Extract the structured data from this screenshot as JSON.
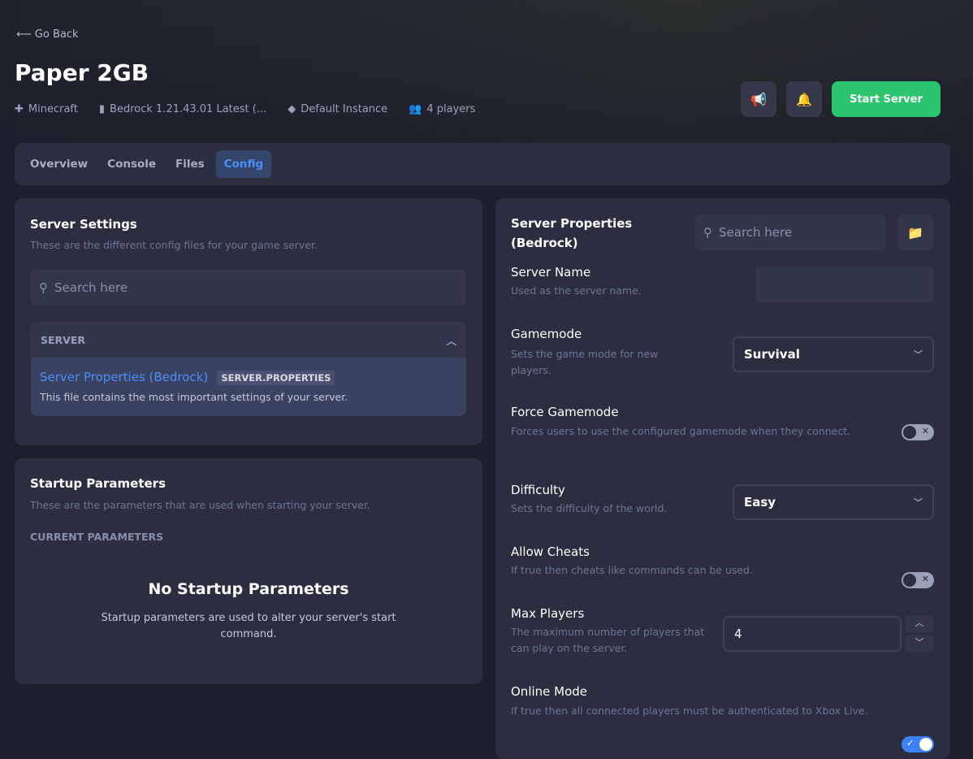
{
  "header": {
    "back": "Go Back",
    "title": "Paper 2GB",
    "game": "Minecraft",
    "version": "Bedrock 1.21.43.01 Latest (...",
    "instance": "Default Instance",
    "players": "4 players",
    "start": "Start Server"
  },
  "tabs": [
    "Overview",
    "Console",
    "Files",
    "Config"
  ],
  "server_settings": {
    "title": "Server Settings",
    "subtitle": "These are the different config files for your game server.",
    "search_placeholder": "Search here",
    "group": "SERVER",
    "file_name": "Server Properties (Bedrock)",
    "file_badge": "SERVER.PROPERTIES",
    "file_desc": "This file contains the most important settings of your server."
  },
  "startup": {
    "title": "Startup Parameters",
    "subtitle": "These are the parameters that are used when starting your server.",
    "current": "CURRENT PARAMETERS",
    "empty_title": "No Startup Parameters",
    "empty_desc": "Startup parameters are used to alter your server's start command."
  },
  "props": {
    "title": "Server Properties (Bedrock)",
    "search_placeholder": "Search here",
    "server_name": {
      "label": "Server Name",
      "desc": "Used as the server name.",
      "value": ""
    },
    "gamemode": {
      "label": "Gamemode",
      "desc": "Sets the game mode for new players.",
      "value": "Survival"
    },
    "force_gamemode": {
      "label": "Force Gamemode",
      "desc": "Forces users to use the configured gamemode when they connect.",
      "on": false
    },
    "difficulty": {
      "label": "Difficulty",
      "desc": "Sets the difficulty of the world.",
      "value": "Easy"
    },
    "allow_cheats": {
      "label": "Allow Cheats",
      "desc": "If true then cheats like commands can be used.",
      "on": false
    },
    "max_players": {
      "label": "Max Players",
      "desc": "The maximum number of players that can play on the server.",
      "value": "4"
    },
    "online_mode": {
      "label": "Online Mode",
      "desc": "If true then all connected players must be authenticated to Xbox Live.",
      "on": true
    }
  }
}
